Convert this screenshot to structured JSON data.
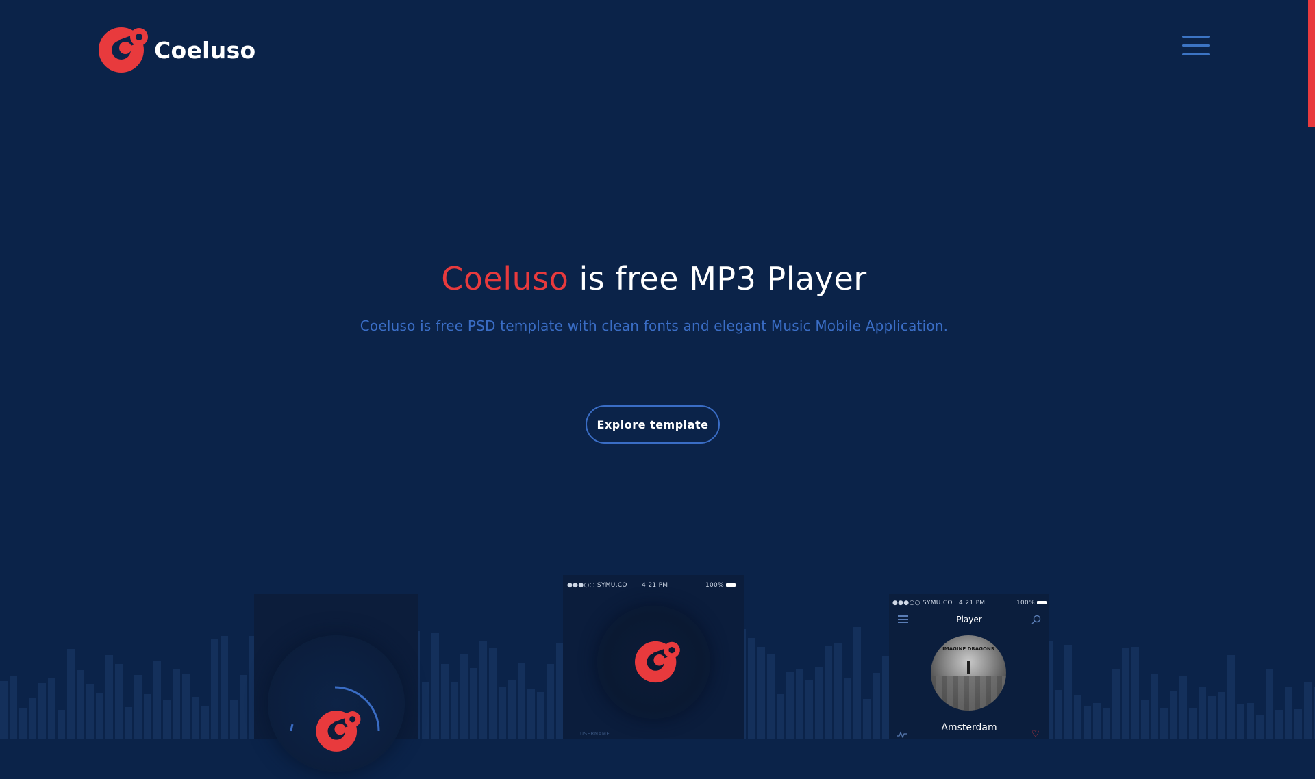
{
  "header": {
    "logo_text": "Coeluso",
    "menu_icon": "hamburger-menu-icon"
  },
  "hero": {
    "title_brand": "Coeluso",
    "title_rest": "is free MP3 Player",
    "subtitle": "Coeluso is free PSD template with clean fonts and elegant Music Mobile Application.",
    "cta_label": "Explore template"
  },
  "phones": {
    "middle": {
      "carrier": "●●●○○ SYMU.CO",
      "time": "4:21 PM",
      "battery": "100%",
      "username_label": "USERNAME"
    },
    "right": {
      "carrier": "●●●○○ SYMU.CO",
      "time": "4:21 PM",
      "battery": "100%",
      "screen_title": "Player",
      "album_label": "IMAGINE DRAGONS",
      "song": "Amsterdam"
    }
  },
  "colors": {
    "background": "#0b2349",
    "accent_red": "#e83a3d",
    "accent_blue": "#3a6dc5",
    "text_white": "#ffffff"
  }
}
